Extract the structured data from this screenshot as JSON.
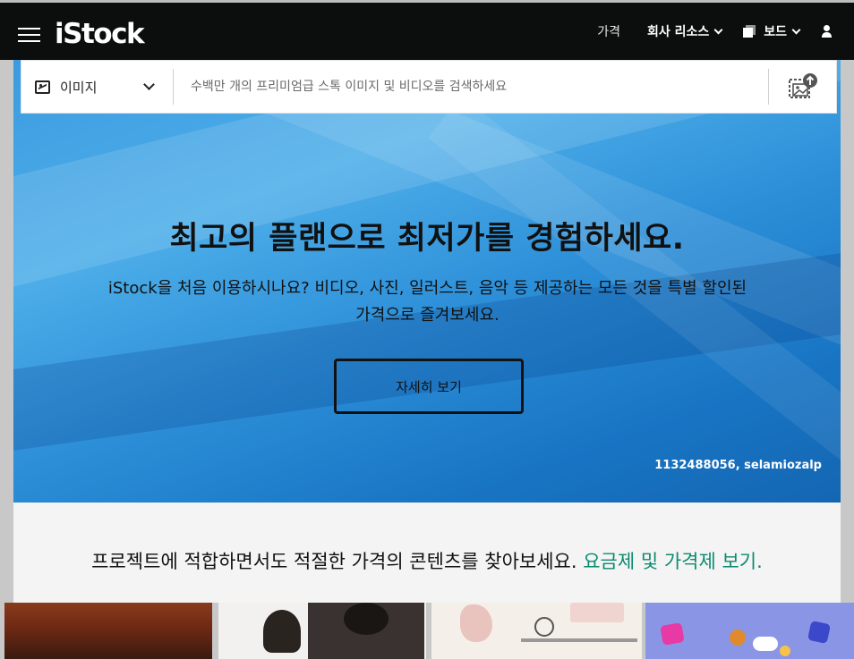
{
  "header": {
    "logo": "iStock",
    "nav": {
      "pricing": "가격",
      "company_resources": "회사 리소스",
      "boards": "보드"
    }
  },
  "search": {
    "type_label": "이미지",
    "placeholder": "수백만 개의 프리미엄급 스톡 이미지 및 비디오를 검색하세요"
  },
  "hero": {
    "title": "최고의 플랜으로 최저가를 경험하세요.",
    "subtitle_line1": "iStock을 처음 이용하시나요? 비디오, 사진, 일러스트, 음악 등 제공하는 모든 것을 특별 할인된",
    "subtitle_line2": "가격으로 즐겨보세요.",
    "button": "자세히 보기",
    "credit": "1132488056, selamiozalp"
  },
  "pricing_band": {
    "text": "프로젝트에 적합하면서도 적절한 가격의 콘텐츠를 찾아보세요. ",
    "link": "요금제 및 가격제 보기."
  },
  "colors": {
    "navbar": "#0c0d0d",
    "hero_blue": "#2d8fd8",
    "link_green": "#0b8a70"
  },
  "icons": [
    "menu-icon",
    "image-icon",
    "chevron-down-icon",
    "visual-search-icon",
    "board-icon",
    "user-icon"
  ]
}
